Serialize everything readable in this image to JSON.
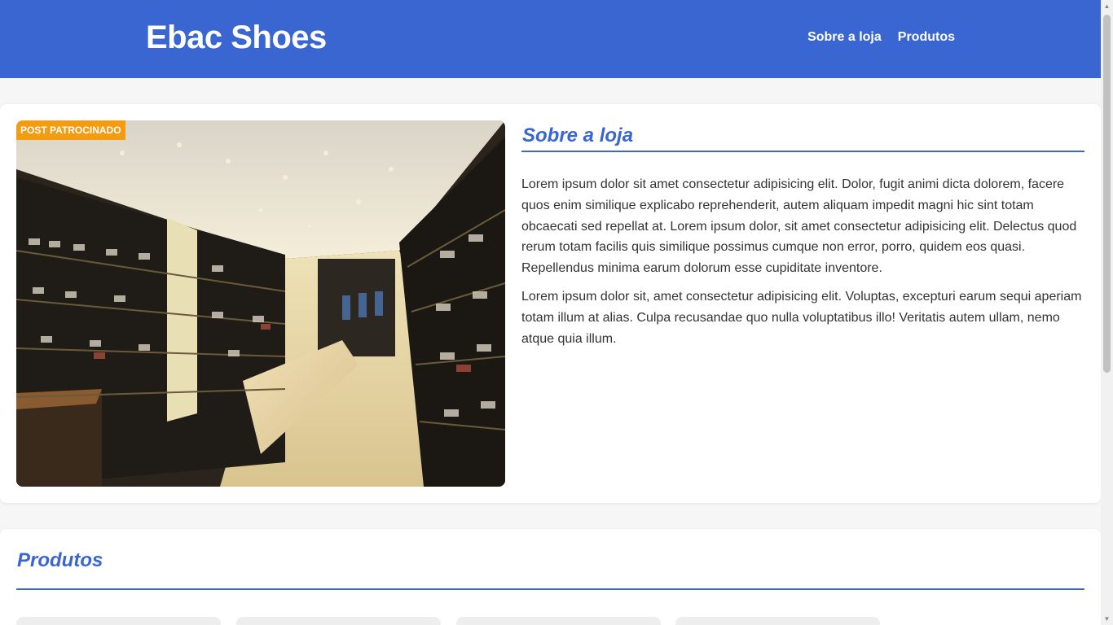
{
  "header": {
    "brand": "Ebac Shoes",
    "nav": [
      "Sobre a loja",
      "Produtos"
    ]
  },
  "about": {
    "badge": "POST PATROCINADO",
    "title": "Sobre a loja",
    "paragraphs": [
      "Lorem ipsum dolor sit amet consectetur adipisicing elit. Dolor, fugit animi dicta dolorem, facere quos enim similique explicabo reprehenderit, autem aliquam impedit magni hic sint totam obcaecati sed repellat at. Lorem ipsum dolor, sit amet consectetur adipisicing elit. Delectus quod rerum totam facilis quis similique possimus cumque non error, porro, quidem eos quasi. Repellendus minima earum dolorum esse cupiditate inventore.",
      "Lorem ipsum dolor sit, amet consectetur adipisicing elit. Voluptas, excepturi earum sequi aperiam totam illum at alias. Culpa recusandae quo nulla voluptatibus illo! Veritatis autem ullam, nemo atque quia illum."
    ]
  },
  "products": {
    "title": "Produtos"
  },
  "colors": {
    "brand": "#3966d0",
    "badge": "#f39c12"
  }
}
